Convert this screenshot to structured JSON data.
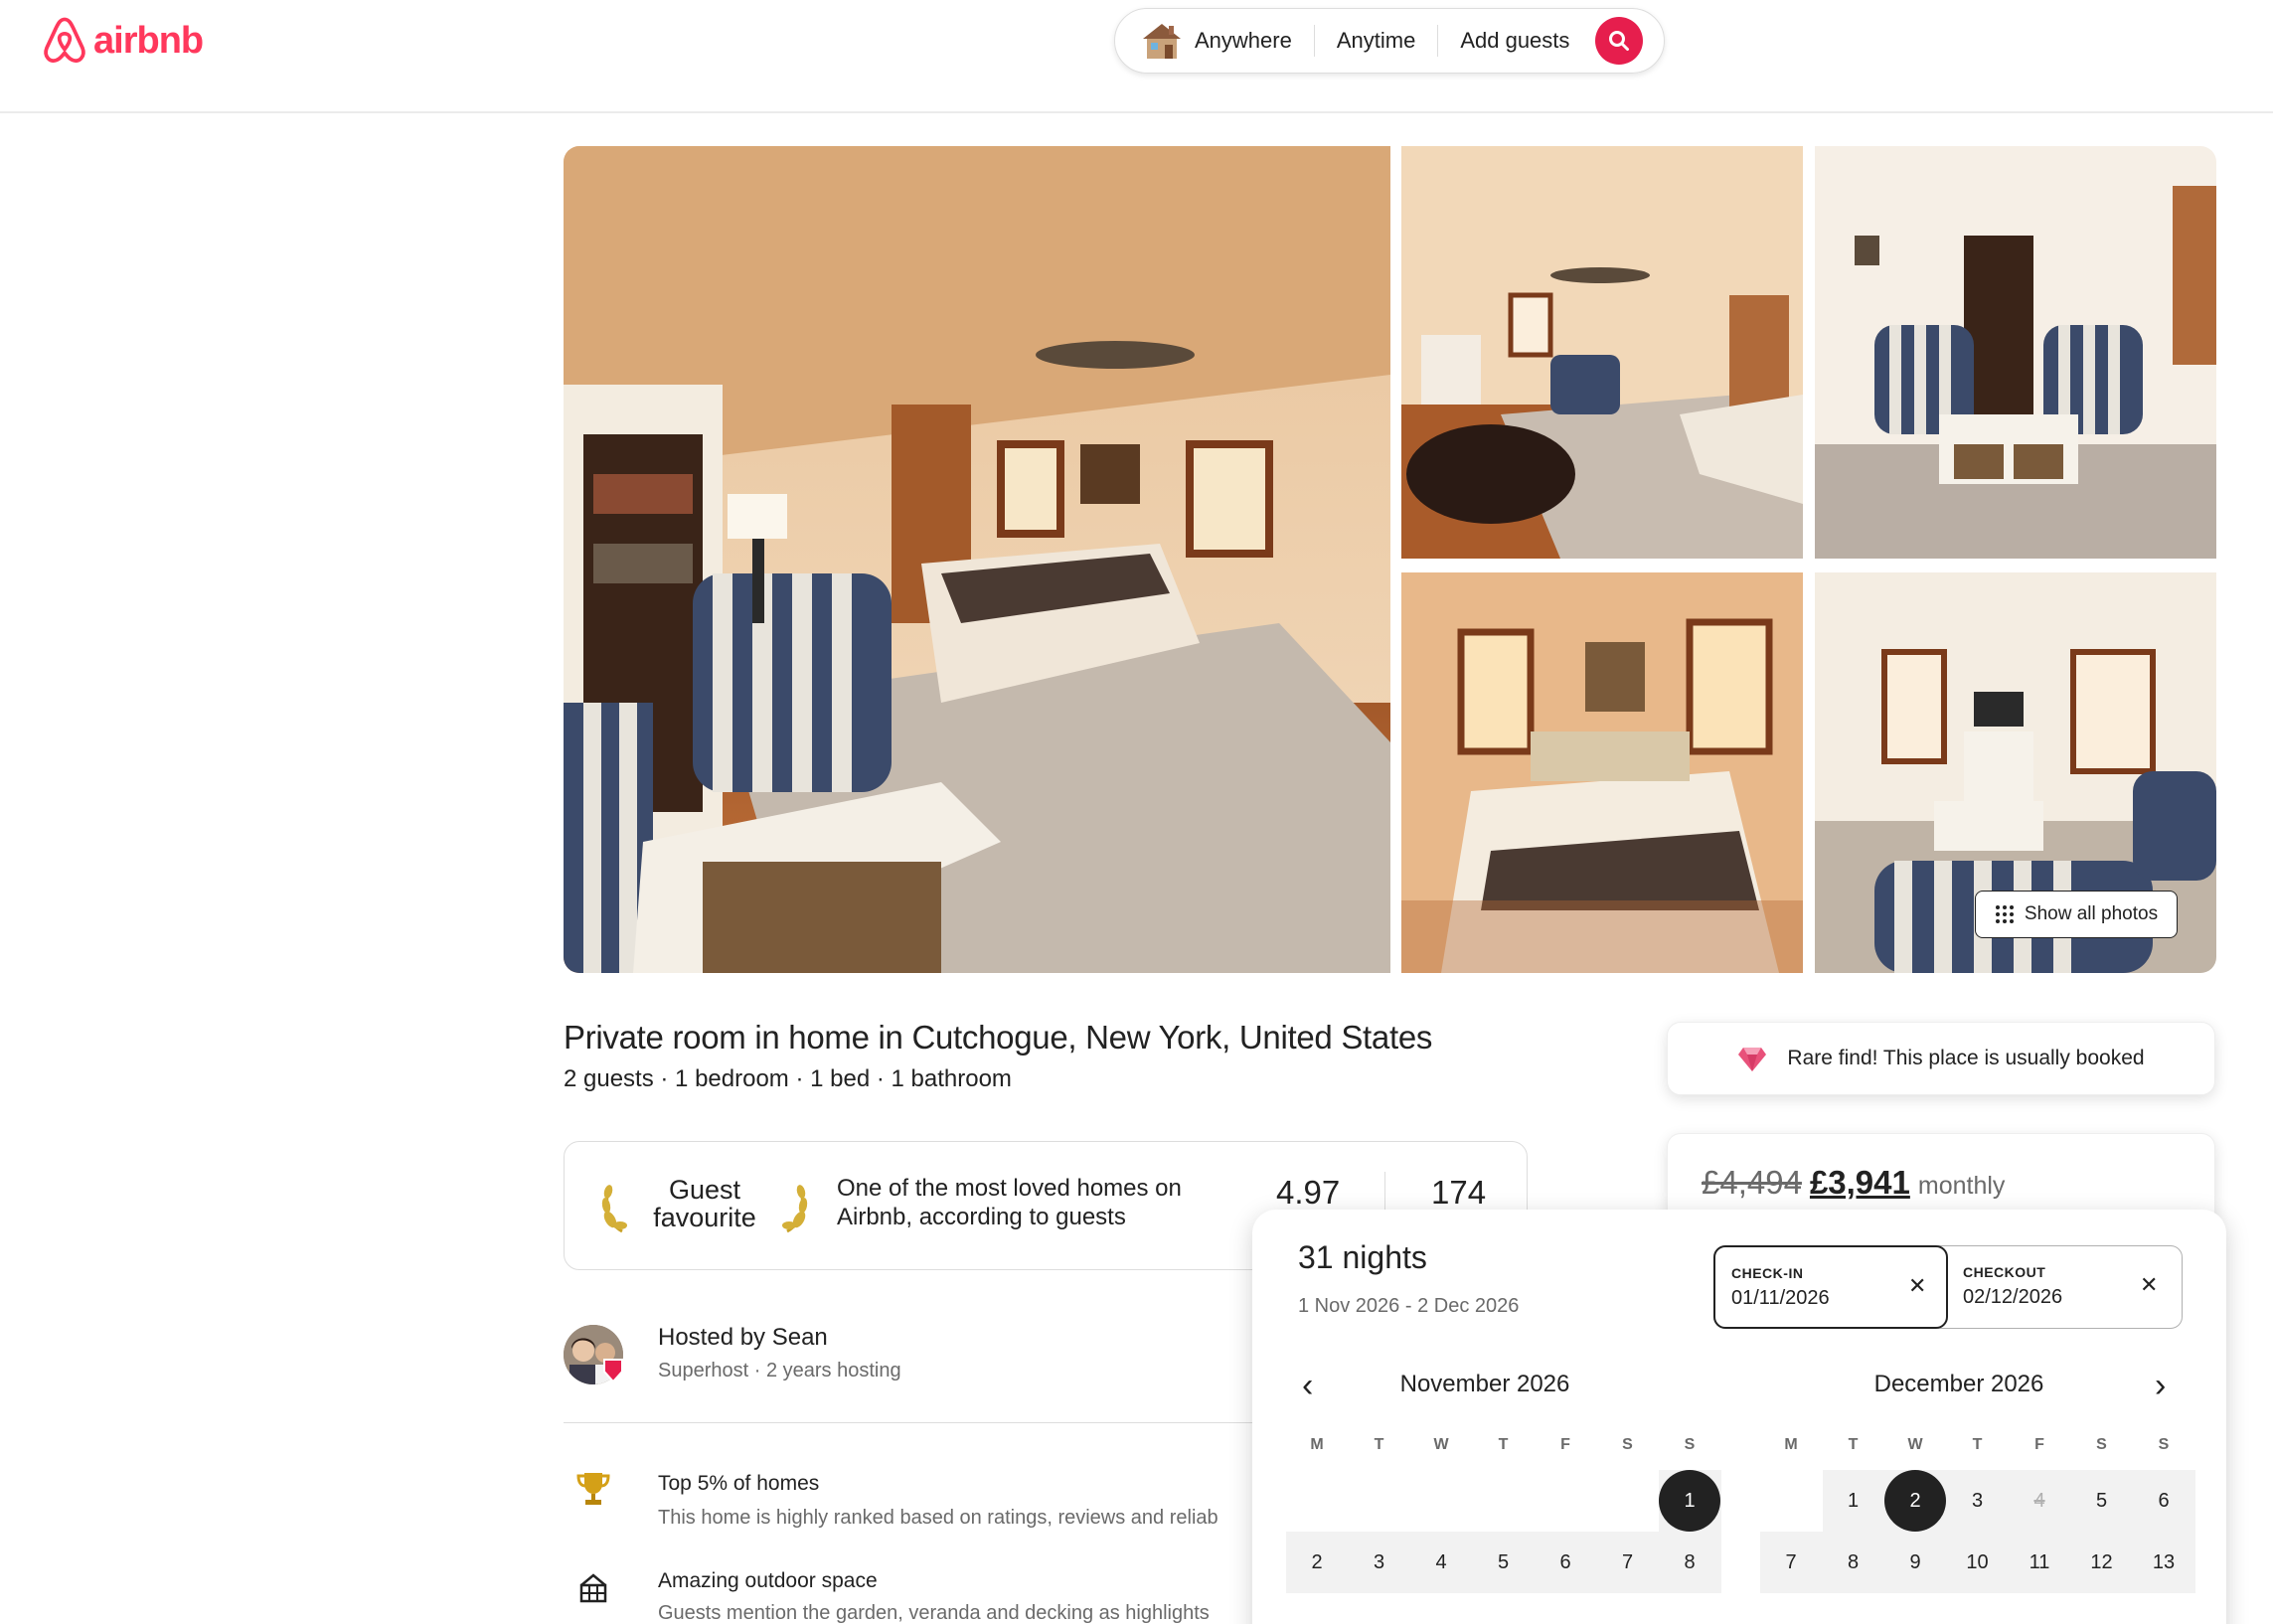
{
  "header": {
    "logo_text": "airbnb",
    "search": {
      "where": "Anywhere",
      "when": "Anytime",
      "who": "Add guests"
    }
  },
  "gallery": {
    "show_all_label": "Show all photos"
  },
  "listing": {
    "title": "Private room in home in Cutchogue, New York, United States",
    "subtitle": "2 guests · 1 bedroom · 1 bed · 1 bathroom"
  },
  "guest_favourite": {
    "badge_line1": "Guest",
    "badge_line2": "favourite",
    "description": "One of the most loved homes on Airbnb, according to guests",
    "rating": "4.97",
    "reviews": "174"
  },
  "host": {
    "name": "Hosted by Sean",
    "details": "Superhost · 2 years hosting"
  },
  "highlights": [
    {
      "icon": "trophy-icon",
      "title": "Top 5% of homes",
      "desc": "This home is highly ranked based on ratings, reviews and reliab"
    },
    {
      "icon": "outdoor-icon",
      "title": "Amazing outdoor space",
      "desc": "Guests mention the garden, veranda and decking as highlights"
    }
  ],
  "booking": {
    "rare_find": "Rare find! This place is usually booked",
    "price_old": "£4,494",
    "price_new": "£3,941",
    "price_unit": "monthly"
  },
  "calendar": {
    "nights": "31 nights",
    "range": "1 Nov 2026 - 2 Dec 2026",
    "checkin_label": "CHECK-IN",
    "checkin_value": "01/11/2026",
    "checkout_label": "CHECKOUT",
    "checkout_value": "02/12/2026",
    "clear_symbol": "✕",
    "prev_symbol": "‹",
    "next_symbol": "›",
    "weekdays": [
      "M",
      "T",
      "W",
      "T",
      "F",
      "S",
      "S"
    ],
    "months": [
      {
        "title": "November 2026",
        "rows": [
          [
            "",
            "",
            "",
            "",
            "",
            "",
            "1"
          ],
          [
            "2",
            "3",
            "4",
            "5",
            "6",
            "7",
            "8"
          ]
        ],
        "selected": [
          "1"
        ],
        "blocked": []
      },
      {
        "title": "December 2026",
        "rows": [
          [
            "",
            "1",
            "2",
            "3",
            "4",
            "5",
            "6"
          ],
          [
            "7",
            "8",
            "9",
            "10",
            "11",
            "12",
            "13"
          ]
        ],
        "selected": [
          "2"
        ],
        "blocked": [
          "4"
        ]
      }
    ]
  }
}
